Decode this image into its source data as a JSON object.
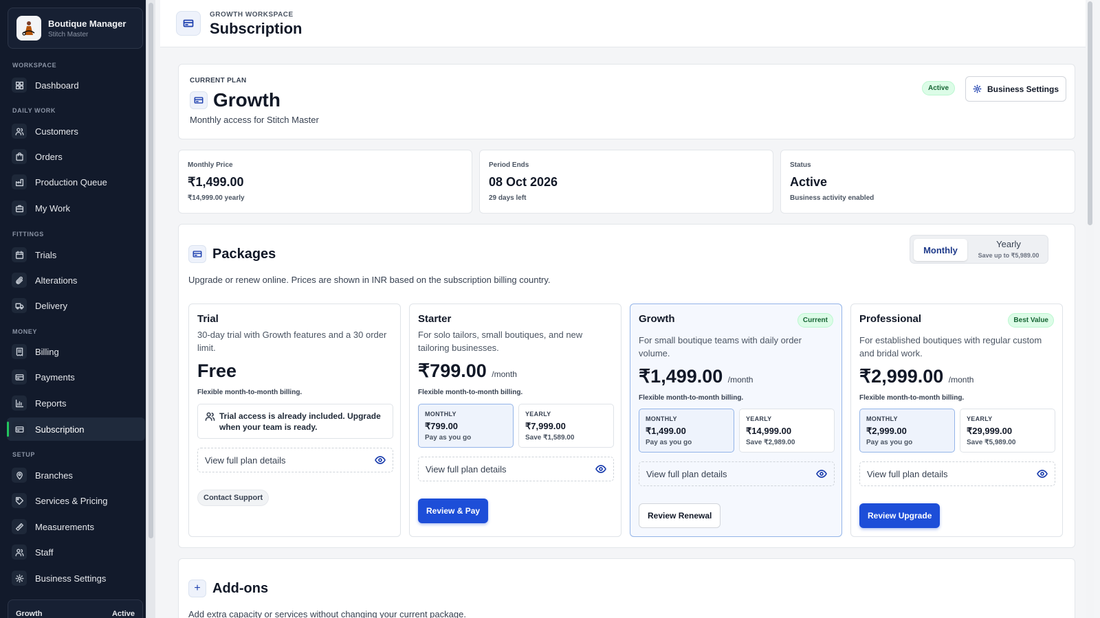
{
  "brand": {
    "title": "Boutique Manager",
    "subtitle": "Stitch Master"
  },
  "sidebar": {
    "sections": {
      "workspace": "WORKSPACE",
      "daily_work": "DAILY WORK",
      "fittings": "FITTINGS",
      "money": "MONEY",
      "setup": "SETUP"
    },
    "items": [
      {
        "label": "Dashboard",
        "icon": "grid-icon"
      },
      {
        "label": "Customers",
        "icon": "users-icon"
      },
      {
        "label": "Orders",
        "icon": "bag-icon"
      },
      {
        "label": "Production Queue",
        "icon": "factory-icon"
      },
      {
        "label": "My Work",
        "icon": "briefcase-icon"
      },
      {
        "label": "Trials",
        "icon": "calendar-icon"
      },
      {
        "label": "Alterations",
        "icon": "paperclip-icon"
      },
      {
        "label": "Delivery",
        "icon": "truck-icon"
      },
      {
        "label": "Billing",
        "icon": "receipt-icon"
      },
      {
        "label": "Payments",
        "icon": "card-icon"
      },
      {
        "label": "Reports",
        "icon": "bar-chart-icon"
      },
      {
        "label": "Subscription",
        "icon": "card-icon",
        "active": true
      },
      {
        "label": "Branches",
        "icon": "map-pin-icon"
      },
      {
        "label": "Services & Pricing",
        "icon": "tag-icon"
      },
      {
        "label": "Measurements",
        "icon": "ruler-icon"
      },
      {
        "label": "Staff",
        "icon": "users-icon"
      },
      {
        "label": "Business Settings",
        "icon": "gear-icon"
      }
    ],
    "footer": {
      "plan": "Growth",
      "status": "Active"
    }
  },
  "header": {
    "eyebrow": "GROWTH WORKSPACE",
    "title": "Subscription"
  },
  "current_plan": {
    "eyebrow": "CURRENT PLAN",
    "name": "Growth",
    "description": "Monthly access for Stitch Master",
    "badge": "Active",
    "settings_button": "Business Settings"
  },
  "stats": [
    {
      "label": "Monthly Price",
      "value": "₹1,499.00",
      "sub": "₹14,999.00 yearly"
    },
    {
      "label": "Period Ends",
      "value": "08 Oct 2026",
      "sub": "29 days left"
    },
    {
      "label": "Status",
      "value": "Active",
      "sub": "Business activity enabled"
    }
  ],
  "packages": {
    "title": "Packages",
    "description": "Upgrade or renew online. Prices are shown in INR based on the subscription billing country.",
    "toggle": {
      "monthly": "Monthly",
      "yearly": "Yearly",
      "yearly_note": "Save up to ₹5,989.00"
    },
    "view_details": "View full plan details",
    "plans": [
      {
        "name": "Trial",
        "badge": "",
        "description": "30-day trial with Growth features and a 30 order limit.",
        "price": "Free",
        "per": "",
        "billing_note": "Flexible month-to-month billing.",
        "note": "Trial access is already included. Upgrade when your team is ready.",
        "action": "Contact Support"
      },
      {
        "name": "Starter",
        "badge": "",
        "description": "For solo tailors, small boutiques, and new tailoring businesses.",
        "price": "₹799.00",
        "per": "/month",
        "billing_note": "Flexible month-to-month billing.",
        "monthly": {
          "label": "MONTHLY",
          "price": "₹799.00",
          "note": "Pay as you go"
        },
        "yearly": {
          "label": "YEARLY",
          "price": "₹7,999.00",
          "note": "Save ₹1,589.00"
        },
        "action": "Review & Pay"
      },
      {
        "name": "Growth",
        "badge": "Current",
        "description": "For small boutique teams with daily order volume.",
        "price": "₹1,499.00",
        "per": "/month",
        "billing_note": "Flexible month-to-month billing.",
        "monthly": {
          "label": "MONTHLY",
          "price": "₹1,499.00",
          "note": "Pay as you go"
        },
        "yearly": {
          "label": "YEARLY",
          "price": "₹14,999.00",
          "note": "Save ₹2,989.00"
        },
        "action": "Review Renewal"
      },
      {
        "name": "Professional",
        "badge": "Best Value",
        "description": "For established boutiques with regular custom and bridal work.",
        "price": "₹2,999.00",
        "per": "/month",
        "billing_note": "Flexible month-to-month billing.",
        "monthly": {
          "label": "MONTHLY",
          "price": "₹2,999.00",
          "note": "Pay as you go"
        },
        "yearly": {
          "label": "YEARLY",
          "price": "₹29,999.00",
          "note": "Save ₹5,989.00"
        },
        "action": "Review Upgrade"
      }
    ]
  },
  "addons": {
    "title": "Add-ons",
    "description": "Add extra capacity or services without changing your current package."
  },
  "colors": {
    "accent": "#1d4ed8",
    "sidebar_bg": "#121a2b",
    "success": "#22c55e"
  }
}
